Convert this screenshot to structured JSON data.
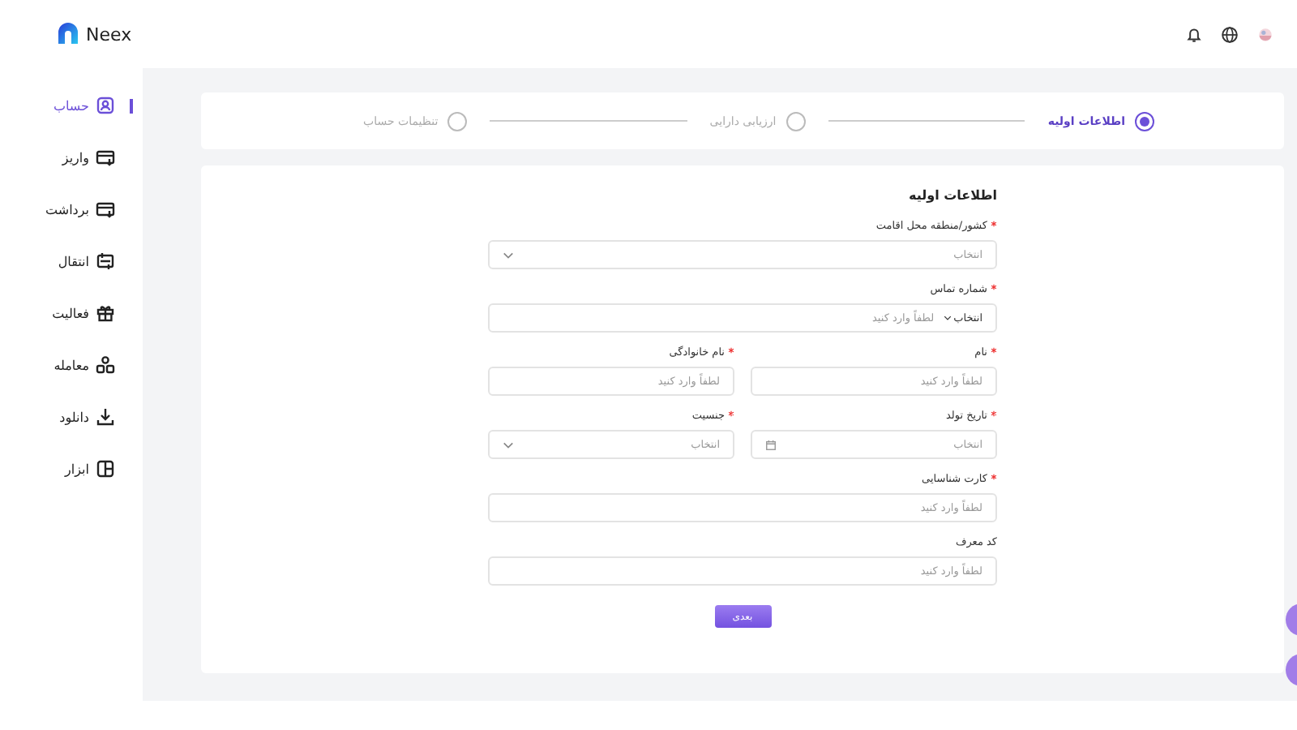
{
  "brand": {
    "name": "Neex"
  },
  "sidebar": {
    "items": [
      {
        "label": "حساب",
        "selected": true
      },
      {
        "label": "واریز",
        "selected": false
      },
      {
        "label": "برداشت",
        "selected": false
      },
      {
        "label": "انتقال",
        "selected": false
      },
      {
        "label": "فعالیت",
        "selected": false
      },
      {
        "label": "معامله",
        "selected": false
      },
      {
        "label": "دانلود",
        "selected": false
      },
      {
        "label": "ابزار",
        "selected": false
      }
    ]
  },
  "stepper": {
    "steps": [
      {
        "label": "اطلاعات اولیه",
        "selected": true
      },
      {
        "label": "ارزیابی دارایی",
        "selected": false
      },
      {
        "label": "تنظیمات حساب",
        "selected": false
      }
    ]
  },
  "form": {
    "title": "اطلاعات اولیه",
    "rows": [
      [
        {
          "kind": "select",
          "label": "کشور/منطقه محل اقامت",
          "required": true,
          "placeholder": "انتخاب"
        }
      ],
      [
        {
          "kind": "phone",
          "label": "شماره تماس",
          "required": true,
          "code_placeholder": "انتخاب",
          "placeholder": "لطفاً وارد کنید"
        }
      ],
      [
        {
          "kind": "text",
          "label": "نام",
          "required": true,
          "placeholder": "لطفاً وارد کنید"
        },
        {
          "kind": "text",
          "label": "نام خانوادگی",
          "required": true,
          "placeholder": "لطفاً وارد کنید"
        }
      ],
      [
        {
          "kind": "date",
          "label": "تاریخ تولد",
          "required": true,
          "placeholder": "انتخاب"
        },
        {
          "kind": "select",
          "label": "جنسیت",
          "required": true,
          "placeholder": "انتخاب"
        }
      ],
      [
        {
          "kind": "text",
          "label": "کارت شناسایی",
          "required": true,
          "placeholder": "لطفاً وارد کنید"
        }
      ],
      [
        {
          "kind": "text",
          "label": "کد معرف",
          "required": false,
          "placeholder": "لطفاً وارد کنید"
        }
      ]
    ],
    "submit": "بعدی"
  }
}
